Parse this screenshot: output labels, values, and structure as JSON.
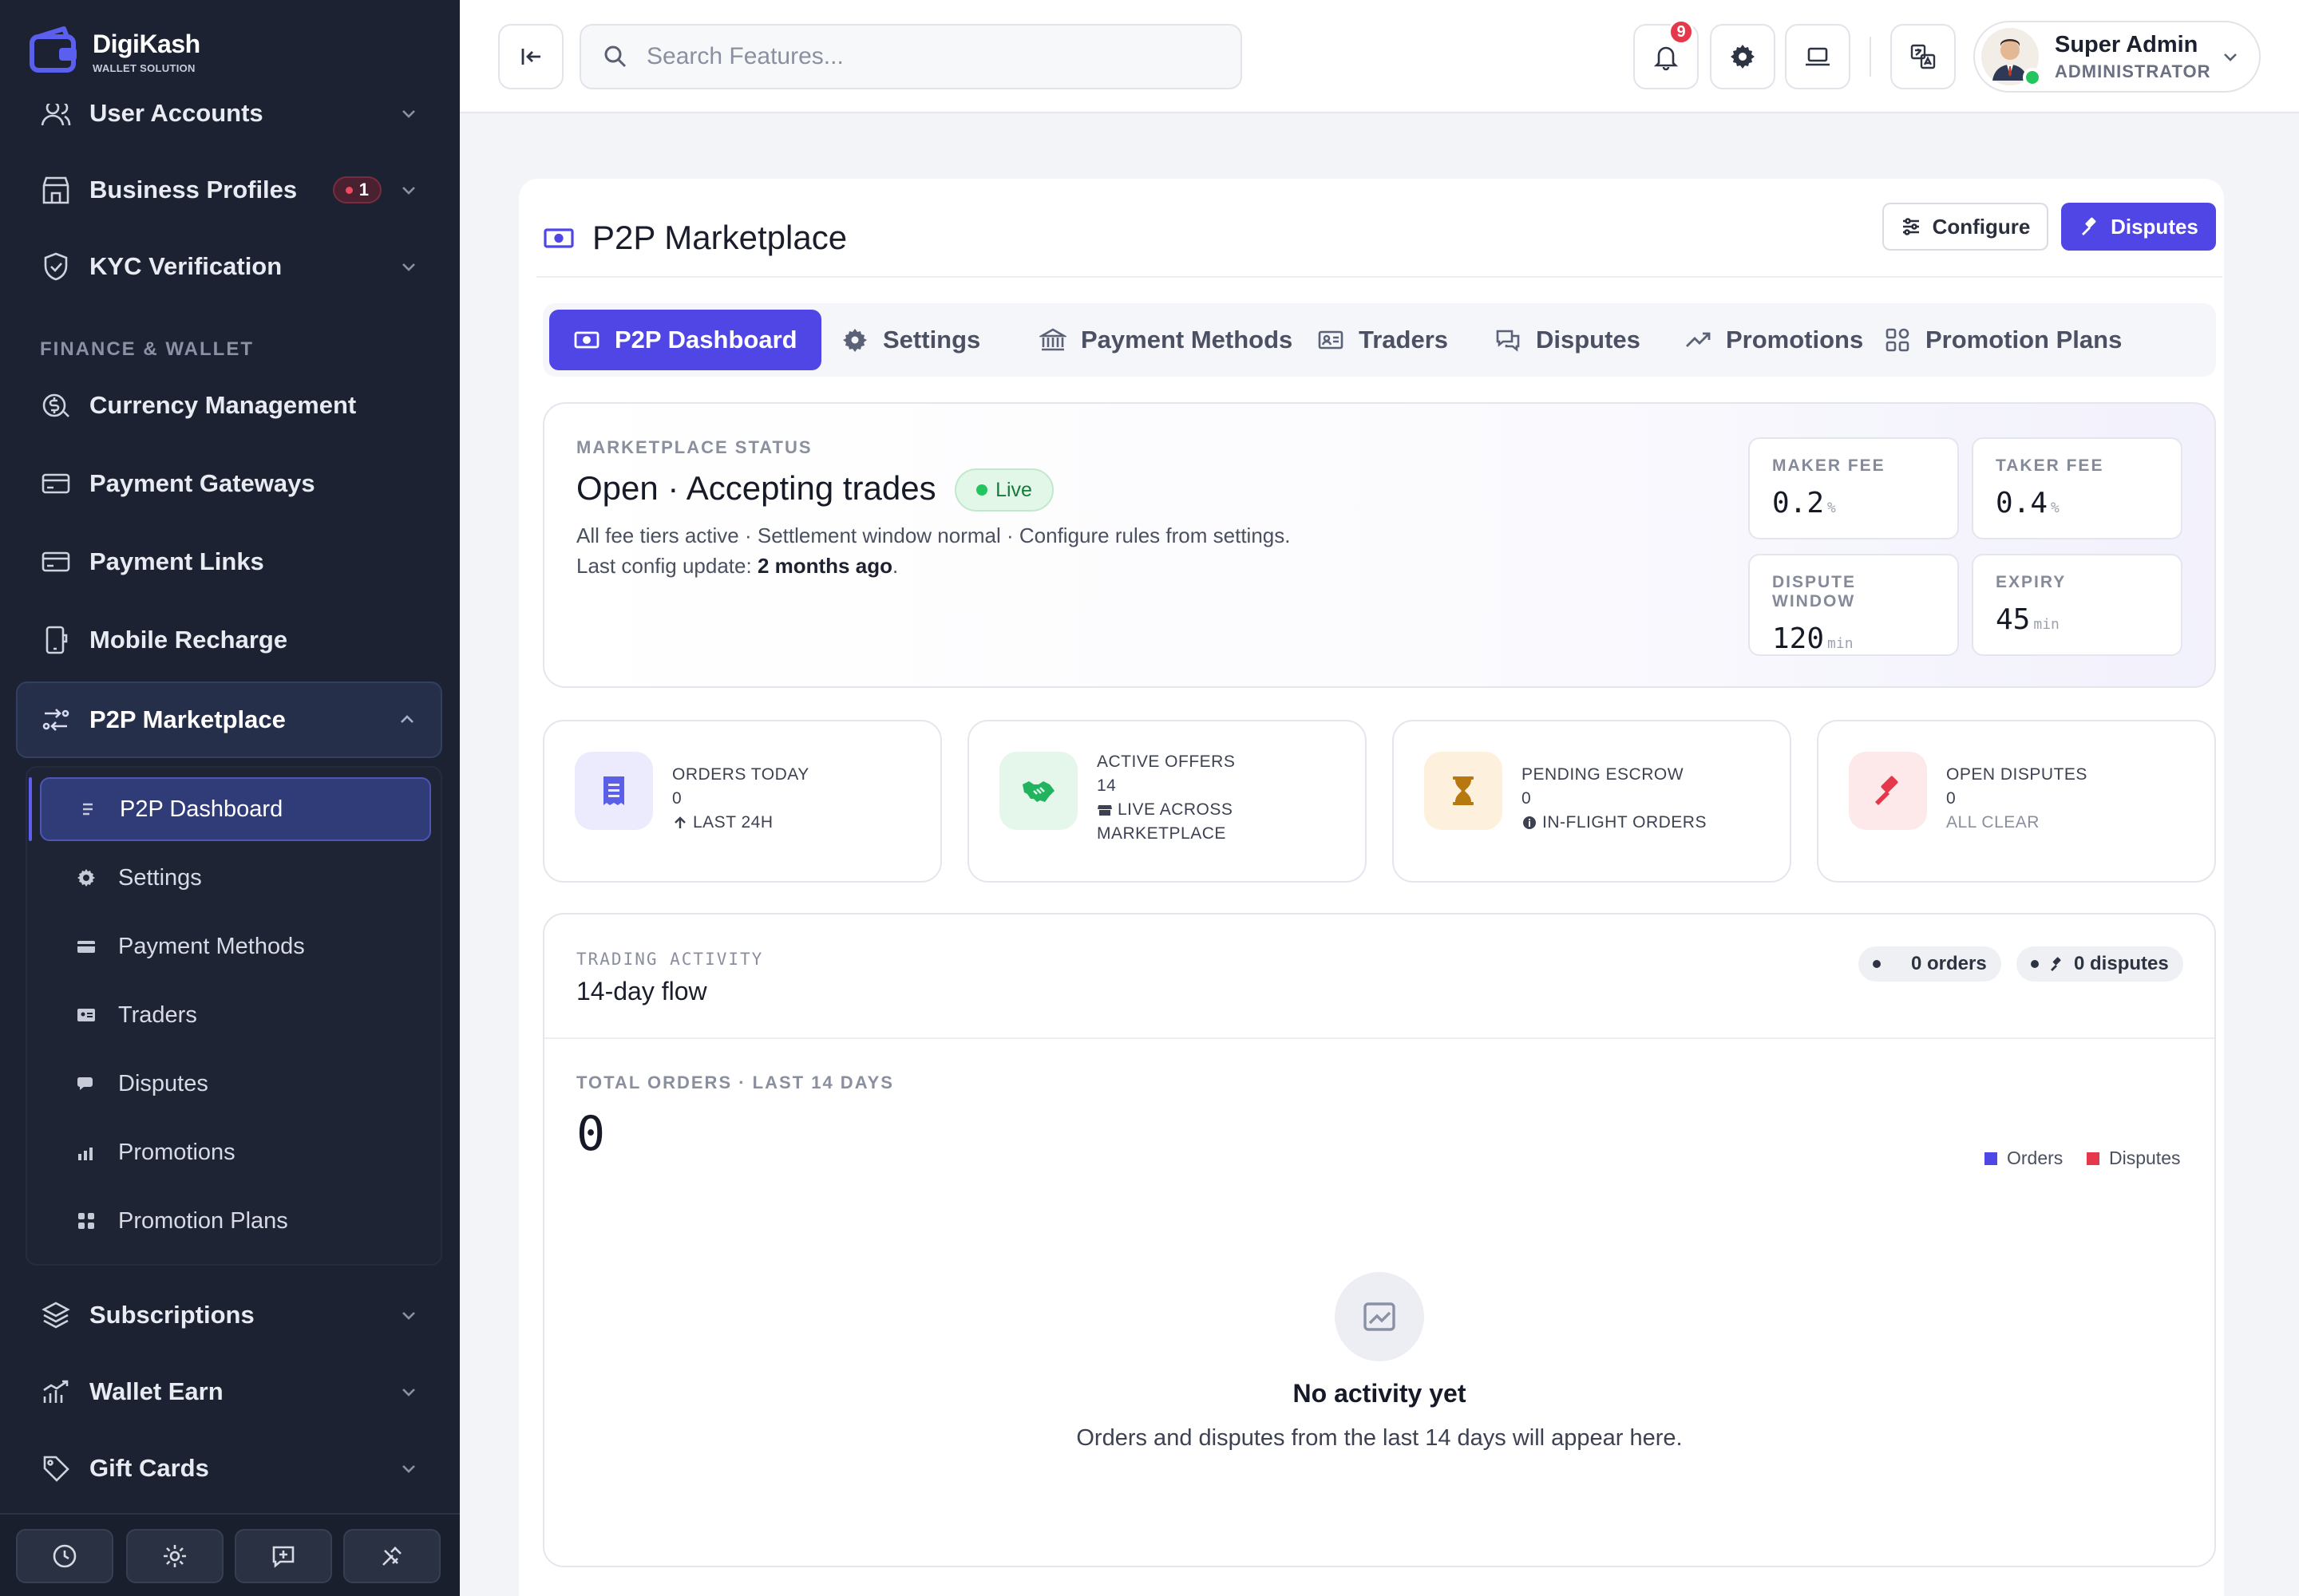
{
  "brand": {
    "name": "DigiKash",
    "tagline": "WALLET SOLUTION"
  },
  "sidebar": {
    "items_top": [
      {
        "label": "User Accounts",
        "icon": "users-icon"
      },
      {
        "label": "Business Profiles",
        "icon": "store-icon",
        "badge": "1"
      },
      {
        "label": "KYC Verification",
        "icon": "shield-check-icon"
      }
    ],
    "section_label": "FINANCE & WALLET",
    "finance_items": [
      {
        "label": "Currency Management",
        "icon": "currency-icon"
      },
      {
        "label": "Payment Gateways",
        "icon": "card-icon"
      },
      {
        "label": "Payment Links",
        "icon": "card-icon"
      },
      {
        "label": "Mobile Recharge",
        "icon": "mobile-icon"
      }
    ],
    "p2p": {
      "label": "P2P Marketplace",
      "children": [
        {
          "label": "P2P Dashboard",
          "active": true
        },
        {
          "label": "Settings"
        },
        {
          "label": "Payment Methods"
        },
        {
          "label": "Traders"
        },
        {
          "label": "Disputes"
        },
        {
          "label": "Promotions"
        },
        {
          "label": "Promotion Plans"
        }
      ]
    },
    "items_bottom": [
      {
        "label": "Subscriptions",
        "icon": "layers-icon"
      },
      {
        "label": "Wallet Earn",
        "icon": "chart-icon"
      },
      {
        "label": "Gift Cards",
        "icon": "tag-icon"
      }
    ]
  },
  "topbar": {
    "search_placeholder": "Search Features...",
    "notification_count": "9",
    "user": {
      "name": "Super Admin",
      "role": "ADMINISTRATOR"
    }
  },
  "page": {
    "title": "P2P Marketplace",
    "configure_label": "Configure",
    "disputes_label": "Disputes",
    "tabs": [
      {
        "label": "P2P Dashboard",
        "active": true
      },
      {
        "label": "Settings"
      },
      {
        "label": "Payment Methods"
      },
      {
        "label": "Traders"
      },
      {
        "label": "Disputes"
      },
      {
        "label": "Promotions"
      },
      {
        "label": "Promotion Plans"
      }
    ]
  },
  "status": {
    "eyebrow": "MARKETPLACE STATUS",
    "title": "Open · Accepting trades",
    "badge": "Live",
    "line1": "All fee tiers active · Settlement window normal · Configure rules from settings.",
    "line2_prefix": "Last config update: ",
    "line2_value": "2 months ago",
    "line2_suffix": ".",
    "fees": [
      {
        "label": "MAKER FEE",
        "value": "0.2",
        "unit": "%"
      },
      {
        "label": "TAKER FEE",
        "value": "0.4",
        "unit": "%"
      },
      {
        "label": "DISPUTE WINDOW",
        "value": "120",
        "unit": "min"
      },
      {
        "label": "EXPIRY",
        "value": "45",
        "unit": "min"
      }
    ]
  },
  "stats": [
    {
      "label": "ORDERS TODAY",
      "value": "0",
      "sub": "LAST 24H",
      "color": "#5b5fe8",
      "bg": "#ecebfd"
    },
    {
      "label": "ACTIVE OFFERS",
      "value": "14",
      "sub": "LIVE ACROSS",
      "sub2": "MARKETPLACE",
      "color": "#22b35e",
      "bg": "#e4f7ea"
    },
    {
      "label": "PENDING ESCROW",
      "value": "0",
      "sub": "IN-FLIGHT ORDERS",
      "color": "#b7790f",
      "bg": "#fdf0dc"
    },
    {
      "label": "OPEN DISPUTES",
      "value": "0",
      "sub": "ALL CLEAR",
      "color": "#e5384a",
      "bg": "#fde8ea"
    }
  ],
  "activity": {
    "eyebrow": "TRADING ACTIVITY",
    "title": "14-day flow",
    "orders_pill": "0 orders",
    "disputes_pill": "0 disputes",
    "total_label": "TOTAL ORDERS · LAST 14 DAYS",
    "total_value": "0",
    "legend": [
      {
        "label": "Orders",
        "color": "#4f46e5"
      },
      {
        "label": "Disputes",
        "color": "#e5384a"
      }
    ],
    "empty_title": "No activity yet",
    "empty_sub": "Orders and disputes from the last 14 days will appear here."
  }
}
